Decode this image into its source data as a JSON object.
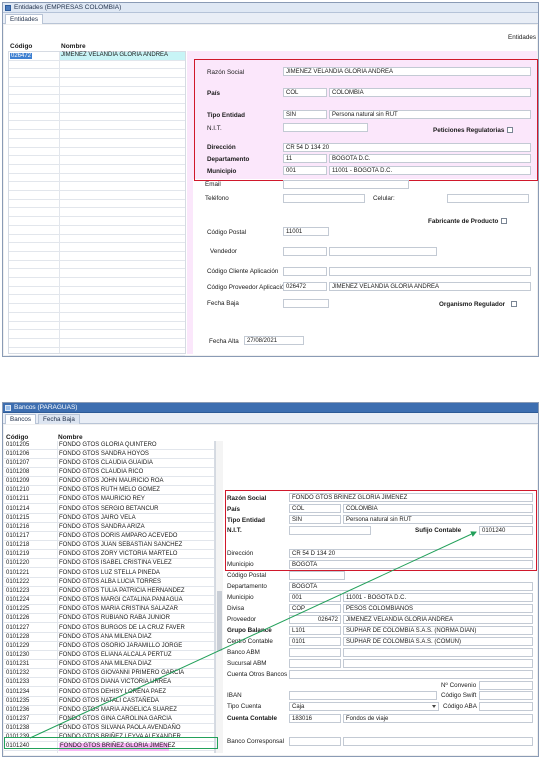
{
  "top": {
    "title": "Entidades (EMPRESAS COLOMBIA)",
    "tab": "Entidades",
    "corner_label": "Entidades",
    "list_headers": {
      "code": "Código",
      "name": "Nombre"
    },
    "list_rows": [
      {
        "code": "026472",
        "name": "JIMENEZ VELANDIA GLORIA ANDREA"
      }
    ],
    "labels": {
      "razon_social": "Razón Social",
      "pais": "País",
      "tipo_entidad": "Tipo Entidad",
      "nit": "N.I.T.",
      "peticiones": "Peticiones Regulatorias",
      "direccion": "Dirección",
      "departamento": "Departamento",
      "municipio": "Municipio",
      "email": "Email",
      "telefono": "Teléfono",
      "celular": "Celular:",
      "fabricante": "Fabricante de Producto",
      "codigo_postal": "Código Postal",
      "vendedor": "Vendedor",
      "cliente_app": "Código Cliente Aplicación",
      "proveedor_app": "Código Proveedor Aplicación",
      "fecha_baja": "Fecha Baja",
      "organismo": "Organismo Regulador",
      "fecha_alta": "Fecha Alta"
    },
    "values": {
      "razon_social": "JIMENEZ VELANDIA GLORIA ANDREA",
      "pais_code": "COL",
      "pais_name": "COLOMBIA",
      "tipo_code": "SIN",
      "tipo_name": "Persona natural sin RUT",
      "direccion": "CR 54 D 134 20",
      "depto_code": "11",
      "depto_name": "BOGOTA D.C.",
      "muni_code": "001",
      "muni_name": "11001 - BOGOTA D.C.",
      "codigo_postal": "11001",
      "proveedor_code": "026472",
      "proveedor_name": "JIMENEZ VELANDIA GLORIA ANDREA",
      "fecha_alta": "27/08/2021"
    }
  },
  "bottom": {
    "title": "Bancos (PARAGUAS)",
    "tabs": [
      "Bancos",
      "Fecha Baja"
    ],
    "list_headers": {
      "code": "Código",
      "name": "Nombre"
    },
    "list_rows": [
      {
        "code": "0101205",
        "name": "FONDO GTOS GLORIA QUINTERO"
      },
      {
        "code": "0101206",
        "name": "FONDO GTOS SANDRA HOYOS"
      },
      {
        "code": "0101207",
        "name": "FONDO GTOS CLAUDIA GUAIDIA"
      },
      {
        "code": "0101208",
        "name": "FONDO GTOS CLAUDIA RICO"
      },
      {
        "code": "0101209",
        "name": "FONDO GTOS JOHN MAURICIO ROA"
      },
      {
        "code": "0101210",
        "name": "FONDO GTOS RUTH MELO GOMEZ"
      },
      {
        "code": "0101211",
        "name": "FONDO GTOS MAURICIO REY"
      },
      {
        "code": "0101214",
        "name": "FONDO GTOS SERGIO BETANCUR"
      },
      {
        "code": "0101215",
        "name": "FONDO GTOS JAIRO VELA"
      },
      {
        "code": "0101216",
        "name": "FONDO GTOS SANDRA ARIZA"
      },
      {
        "code": "0101217",
        "name": "FONDO GTOS DORIS AMPARO ACEVEDO"
      },
      {
        "code": "0101218",
        "name": "FONDO GTOS JUAN SEBASTIAN SANCHEZ"
      },
      {
        "code": "0101219",
        "name": "FONDO GTOS ZORY VICTORIA MARTELO"
      },
      {
        "code": "0101220",
        "name": "FONDO GTOS ISABEL CRISTINA VELEZ"
      },
      {
        "code": "0101221",
        "name": "FONDO GTOS LUZ STELLA PINEDA"
      },
      {
        "code": "0101222",
        "name": "FONDO GTOS ALBA LUCIA TORRES"
      },
      {
        "code": "0101223",
        "name": "FONDO GTOS TULIA PATRICIA HERNANDEZ"
      },
      {
        "code": "0101224",
        "name": "FONDO GTOS MARGI CATALINA PANIAGUA"
      },
      {
        "code": "0101225",
        "name": "FONDO GTOS MARIA CRISTINA SALAZAR"
      },
      {
        "code": "0101226",
        "name": "FONDO GTOS RUBIANO RABA JUNIOR"
      },
      {
        "code": "0101227",
        "name": "FONDO GTOS BURGOS DE LA CRUZ FAVER"
      },
      {
        "code": "0101228",
        "name": "FONDO GTOS ANA MILENA DIAZ"
      },
      {
        "code": "0101229",
        "name": "FONDO GTOS OSORIO JARAMILLO JORGE"
      },
      {
        "code": "0101230",
        "name": "FONDO GTOS ELIANA ALCALA PERTUZ"
      },
      {
        "code": "0101231",
        "name": "FONDO GTOS ANA MILENA DIAZ"
      },
      {
        "code": "0101232",
        "name": "FONDO GTOS GIOVANNI PRIMERO GARCIA"
      },
      {
        "code": "0101233",
        "name": "FONDO GTOS DIANA VICTORIA URREA"
      },
      {
        "code": "0101234",
        "name": "FONDO GTOS DEHISY LORENA PAEZ"
      },
      {
        "code": "0101235",
        "name": "FONDO GTOS NATALI CASTAÑEDA"
      },
      {
        "code": "0101236",
        "name": "FONDO GTOS MARIA ANGELICA SUAREZ"
      },
      {
        "code": "0101237",
        "name": "FONDO GTOS GINA CAROLINA GARCIA"
      },
      {
        "code": "0101238",
        "name": "FONDO GTOS SILVANA PAOLA AVENDAÑO"
      },
      {
        "code": "0101239",
        "name": "FONDO GTOS BRIÑEZ LEYVA ALEXANDER"
      },
      {
        "code": "0101240",
        "name": "FONDO GTOS BRIÑEZ GLORIA JIMENEZ"
      }
    ],
    "labels": {
      "razon_social": "Razón Social",
      "pais": "País",
      "tipo_entidad": "Tipo Entidad",
      "nit": "N.I.T.",
      "sufijo": "Sufijo Contable",
      "direccion": "Dirección",
      "municipio": "Municipio",
      "codigo_postal": "Código Postal",
      "departamento": "Departamento",
      "municipio2": "Municipio",
      "divisa": "Divisa",
      "proveedor": "Proveedor",
      "grupo_balance": "Grupo Balance",
      "centro_contable": "Centro Contable",
      "banco_abm": "Banco ABM",
      "sucursal_abm": "Sucursal ABM",
      "cuenta_otros": "Cuenta Otros Bancos",
      "n_convenio": "Nº Convenio",
      "iban": "IBAN",
      "codigo_swift": "Código Swift",
      "tipo_cuenta": "Tipo Cuenta",
      "codigo_aba": "Código ABA",
      "cuenta_contable": "Cuenta Contable",
      "banco_corresponsal": "Banco Corresponsal"
    },
    "values": {
      "razon_social": "FONDO GTOS BRIÑEZ GLORIA JIMENEZ",
      "pais_code": "COL",
      "pais_name": "COLOMBIA",
      "tipo_code": "SIN",
      "tipo_name": "Persona natural sin RUT",
      "sufijo": "0101240",
      "direccion": "CR 54 D 134 20",
      "municipio": "BOGOTA",
      "departamento": "BOGOTA",
      "muni_code": "001",
      "muni_name": "11001 - BOGOTA D.C.",
      "divisa_code": "COP",
      "divisa_name": "PESOS COLOMBIANOS",
      "proveedor_code": "026472",
      "proveedor_name": "JIMENEZ VELANDIA GLORIA ANDREA",
      "grupo_code": "L101",
      "grupo_name": "SUPHAR DE COLOMBIA S.A.S. (NORMA DIAN)",
      "centro_code": "0101",
      "centro_name": "SUPHAR DE COLOMBIA S.A.S. (COMUN)",
      "tipo_cuenta": "Caja",
      "cuenta_contable_code": "183016",
      "cuenta_contable_name": "Fondos de viaje"
    }
  },
  "colors": {
    "selection_pink": "#f7b6f4",
    "highlight_cyan": "#c8f4f6",
    "selected_blue": "#3d7fd1",
    "red_box": "#d0182b",
    "green": "#22a05a"
  }
}
